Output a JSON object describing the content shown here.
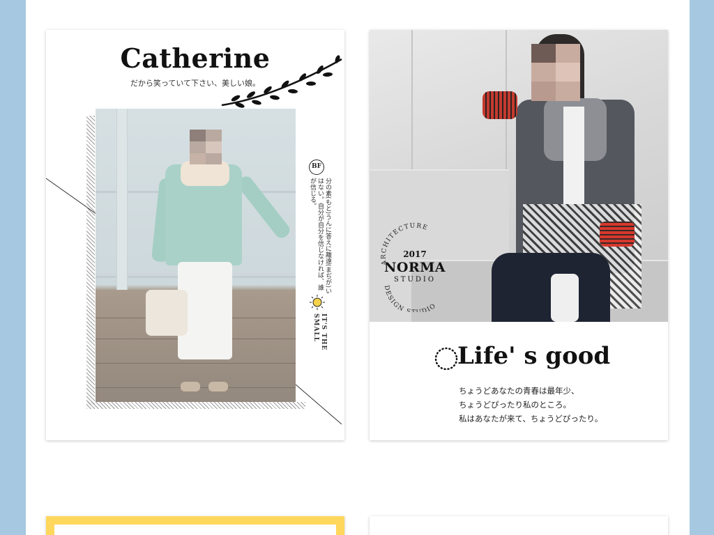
{
  "card1": {
    "title": "Catherine",
    "subtitle": "だから笑っていて下さい、美しい娘。",
    "badge": "BF",
    "vertical_text": "分の素(もと)うんに答えに離遠(まぢが)いはない。自分が自分を信じなければ、誰が信じる。",
    "small_text": "IT'S THE SMALL",
    "icons": [
      "branch-icon",
      "sun-icon"
    ]
  },
  "card2": {
    "stamp": {
      "top_arc": "ARCHITECTURE",
      "year": "2017",
      "name": "NORMA",
      "studio": "STUDIO",
      "bottom_arc": "DESIGN STUDIO"
    },
    "headline": "Life' s good",
    "body_lines": [
      "ちょうどあなたの青春は最年少、",
      "ちょうどぴったり私のところ。",
      "私はあなたが来て、ちょうどぴったり。"
    ]
  },
  "colors": {
    "page_background": "#a6c8e1",
    "card3_border": "#ffd75c",
    "text": "#111111"
  }
}
